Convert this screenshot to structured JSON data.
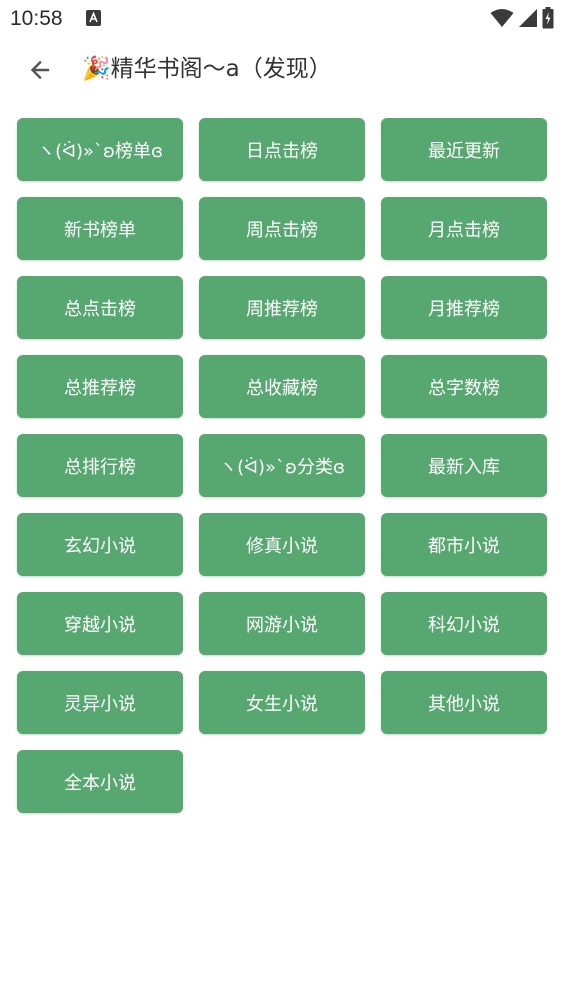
{
  "status_bar": {
    "time": "10:58",
    "notification_icon": "a-notification-icon",
    "icons": [
      "wifi-icon",
      "signal-icon",
      "battery-icon"
    ]
  },
  "app_bar": {
    "back_icon": "arrow-left-icon",
    "title": "🎉精华书阁～a（发现）"
  },
  "colors": {
    "button_bg": "#56a770",
    "button_text": "#ffffff"
  },
  "buttons": [
    {
      "label": "ヽ(ᐛ)»`ʚ榜单ɞ"
    },
    {
      "label": "日点击榜"
    },
    {
      "label": "最近更新"
    },
    {
      "label": "新书榜单"
    },
    {
      "label": "周点击榜"
    },
    {
      "label": "月点击榜"
    },
    {
      "label": "总点击榜"
    },
    {
      "label": "周推荐榜"
    },
    {
      "label": "月推荐榜"
    },
    {
      "label": "总推荐榜"
    },
    {
      "label": "总收藏榜"
    },
    {
      "label": "总字数榜"
    },
    {
      "label": "总排行榜"
    },
    {
      "label": "ヽ(ᐛ)»`ʚ分类ɞ"
    },
    {
      "label": "最新入库"
    },
    {
      "label": "玄幻小说"
    },
    {
      "label": "修真小说"
    },
    {
      "label": "都市小说"
    },
    {
      "label": "穿越小说"
    },
    {
      "label": "网游小说"
    },
    {
      "label": "科幻小说"
    },
    {
      "label": "灵异小说"
    },
    {
      "label": "女生小说"
    },
    {
      "label": "其他小说"
    },
    {
      "label": "全本小说"
    }
  ]
}
